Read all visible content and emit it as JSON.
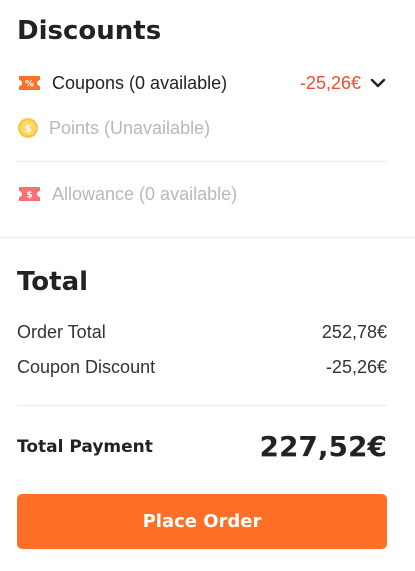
{
  "discounts": {
    "title": "Discounts",
    "coupons": {
      "label": "Coupons (0 available)",
      "value": "-25,26€",
      "icon": "coupon-icon"
    },
    "points": {
      "label": "Points (Unavailable)",
      "icon": "coin-icon"
    },
    "allowance": {
      "label": "Allowance (0 available)",
      "icon": "allowance-icon"
    }
  },
  "total": {
    "title": "Total",
    "order_total_label": "Order Total",
    "order_total_value": "252,78€",
    "coupon_discount_label": "Coupon Discount",
    "coupon_discount_value": "-25,26€",
    "payment_label": "Total Payment",
    "payment_value": "227,52€",
    "place_order_label": "Place Order"
  },
  "colors": {
    "accent": "#ff6f28",
    "discount_red": "#ee4d2d",
    "disabled_text": "#b8b8b8",
    "coin_yellow": "#f7c948"
  }
}
